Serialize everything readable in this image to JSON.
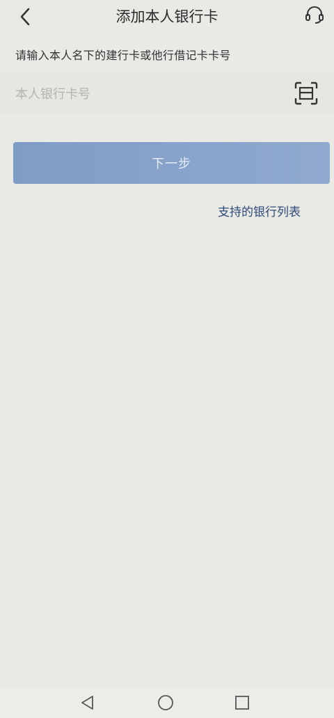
{
  "header": {
    "title": "添加本人银行卡",
    "back_icon": "chevron-left-icon",
    "service_icon": "headset-icon"
  },
  "hint": "请输入本人名下的建行卡或他行借记卡卡号",
  "card_input": {
    "placeholder": "本人银行卡号",
    "value": "",
    "scan_icon": "scan-icon"
  },
  "next_button": {
    "label": "下一步"
  },
  "bank_list_link": "支持的银行列表",
  "navbar": {
    "back_icon": "triangle-back-icon",
    "home_icon": "circle-home-icon",
    "recents_icon": "square-recents-icon"
  },
  "colors": {
    "background": "#e9e9e5",
    "button": "#8aa4cc",
    "link": "#2d4a78"
  }
}
